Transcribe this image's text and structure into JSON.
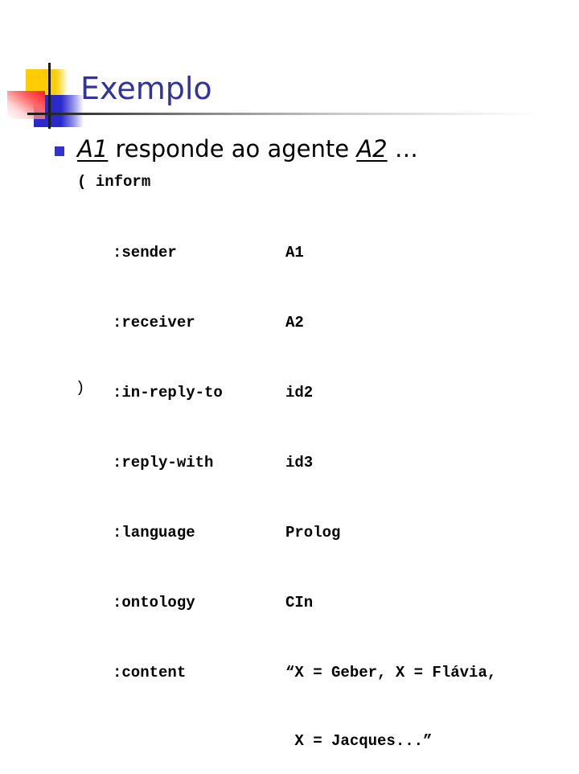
{
  "slide": {
    "title": "Exemplo",
    "heading": {
      "agent_from": "A1",
      "middle_text": " responde ao agente ",
      "agent_to": "A2",
      "ellipsis": " …"
    },
    "message": {
      "open": "( inform",
      "close": ")",
      "fields": [
        {
          "param": ":sender",
          "value": "A1"
        },
        {
          "param": ":receiver",
          "value": "A2"
        },
        {
          "param": ":in-reply-to",
          "value": "id2"
        },
        {
          "param": ":reply-with",
          "value": "id3"
        },
        {
          "param": ":language",
          "value": "Prolog"
        },
        {
          "param": ":ontology",
          "value": "CIn"
        },
        {
          "param": ":content",
          "value": "“X = Geber, X = Flávia,"
        }
      ],
      "content_continuation": " X = Jacques...”"
    }
  },
  "colors": {
    "title": "#333399",
    "bullet": "#3333cc",
    "logo_yellow": "#ffcc00",
    "logo_blue": "#2a2acc",
    "logo_red": "#ff1a1a"
  }
}
